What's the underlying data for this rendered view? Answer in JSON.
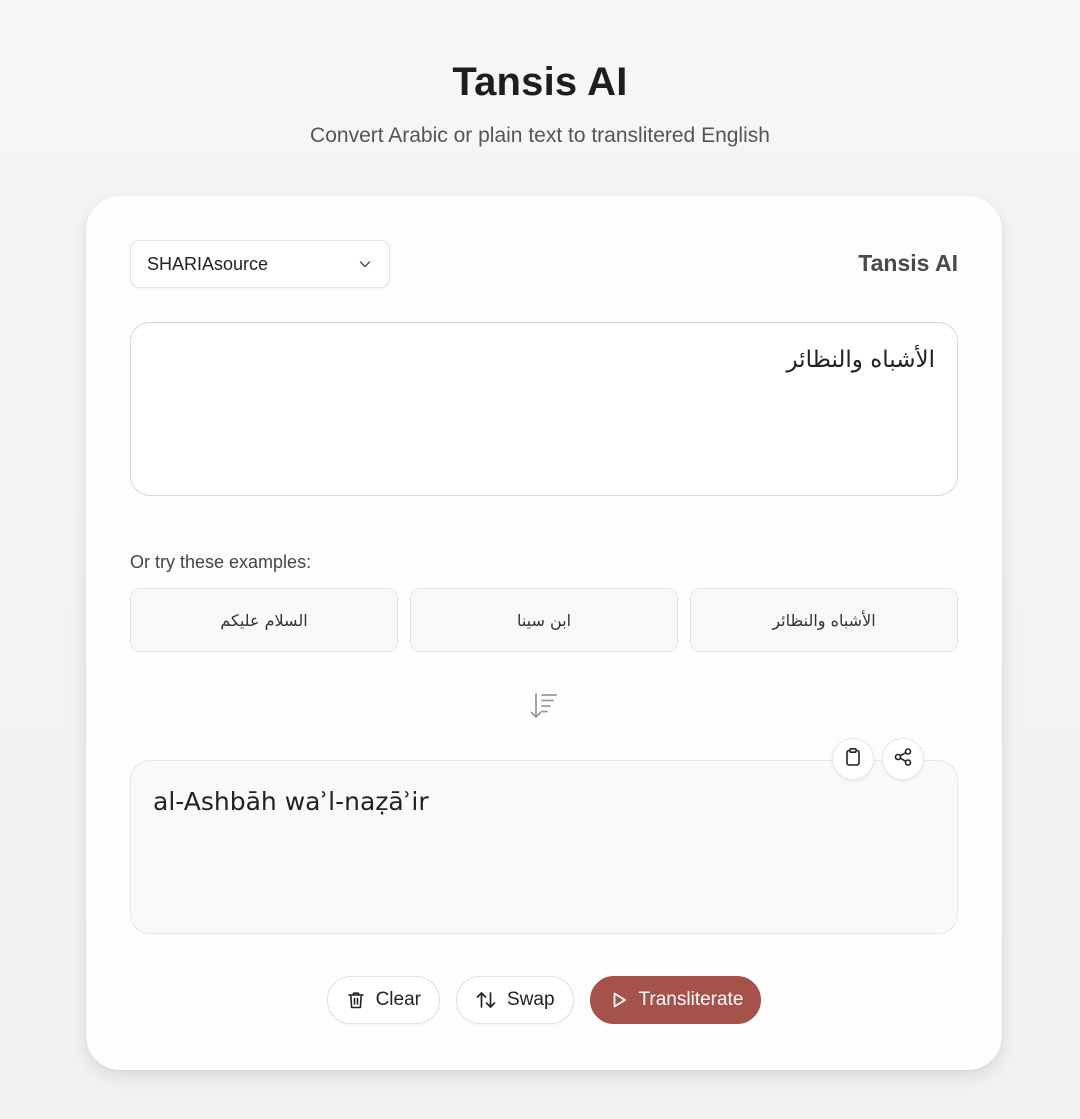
{
  "header": {
    "title": "Tansis AI",
    "subtitle": "Convert Arabic or plain text to translitered English"
  },
  "source_select": {
    "selected": "SHARIAsource",
    "icon": "chevron-down-icon"
  },
  "card": {
    "brand_label": "Tansis AI"
  },
  "input": {
    "value": "الأشباه والنظائر"
  },
  "examples": {
    "label": "Or try these examples:",
    "items": [
      "السلام عليكم",
      "ابن سينا",
      "الأشباه والنظائر"
    ]
  },
  "divider_icon": "sort-down-icon",
  "output": {
    "value": "al-Ashbāh waʾl-naẓāʾir",
    "copy_icon": "clipboard-icon",
    "share_icon": "share-icon"
  },
  "actions": {
    "clear_label": "Clear",
    "swap_label": "Swap",
    "transliterate_label": "Transliterate"
  },
  "colors": {
    "primary": "#a4524a",
    "background": "#f4f4f4",
    "card": "#fdfdfd"
  }
}
